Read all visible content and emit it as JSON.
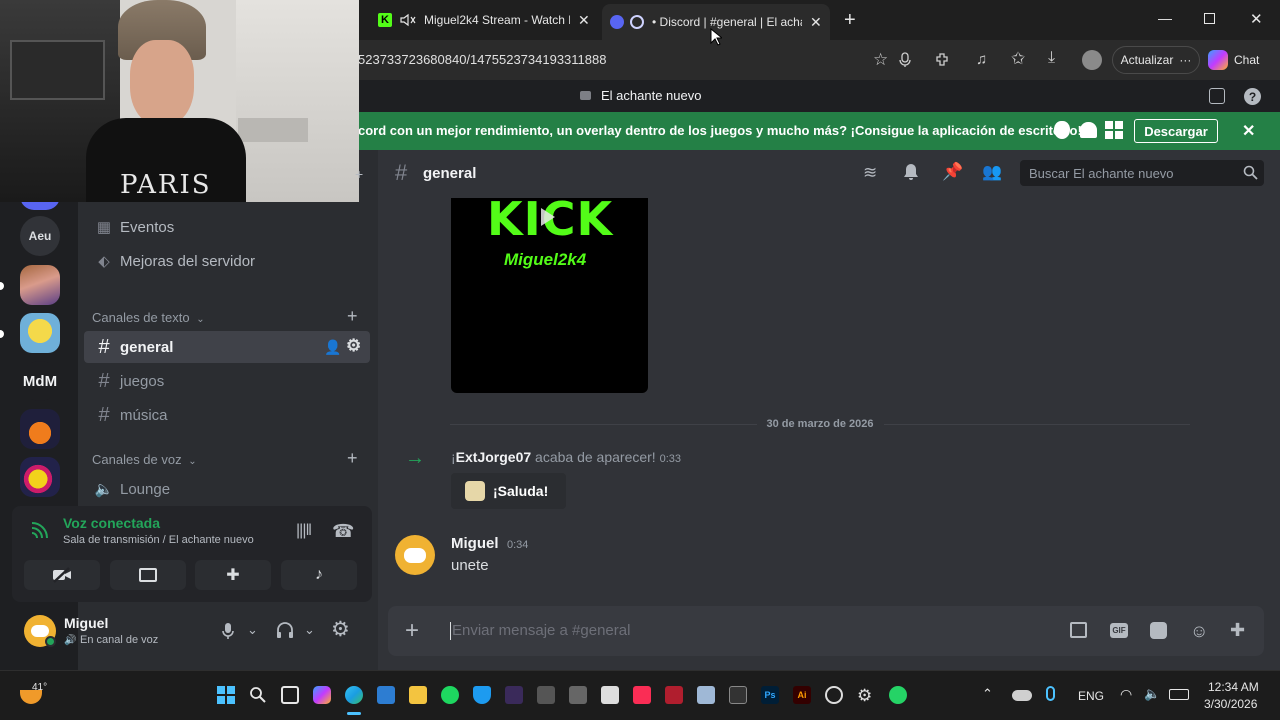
{
  "browser": {
    "tabs": [
      {
        "title": "Miguel2k4 Stream - Watch L",
        "favicon": "kick-icon"
      },
      {
        "title": "• Discord | #general | El acha",
        "favicon": "discord-icon"
      }
    ],
    "url": "523733723680840/1475523734193311888",
    "update_label": "Actualizar",
    "chat_label": "Chat"
  },
  "discord": {
    "server_title": "El achante nuevo",
    "banner": {
      "text": "cord con un mejor rendimiento, un overlay dentro de los juegos y mucho más? ¡Consigue la aplicación de escritorio!",
      "download_label": "Descargar"
    },
    "servers": {
      "aeu_label": "Aeu",
      "mdm_label": "MdM"
    },
    "menu": {
      "events": "Eventos",
      "boosts": "Mejoras del servidor"
    },
    "categories": {
      "text": "Canales de texto",
      "voice": "Canales de voz"
    },
    "channels": {
      "general": "general",
      "juegos": "juegos",
      "musica": "música",
      "lounge": "Lounge"
    },
    "voice": {
      "status": "Voz conectada",
      "detail": "Sala de transmisión / El achante nuevo"
    },
    "user": {
      "name": "Miguel",
      "status": "En canal de voz"
    },
    "chat": {
      "channel": "general",
      "search_placeholder": "Buscar El achante nuevo",
      "embed_brand": "KICK",
      "embed_user": "Miguel2k4",
      "date_divider": "30 de marzo de 2026",
      "join_prefix": "¡",
      "join_user": "ExtJorge07",
      "join_text": "acaba de aparecer!",
      "join_time": "0:33",
      "wave_label": "¡Saluda!",
      "message_author": "Miguel",
      "message_time": "0:34",
      "message_text": "unete",
      "composer_placeholder": "Enviar mensaje a #general"
    }
  },
  "webcam": {
    "shirt_text": "PARIS"
  },
  "taskbar": {
    "weather": "41°",
    "language": "ENG",
    "time": "12:34 AM",
    "date": "3/30/2026"
  },
  "colors": {
    "discord_green": "#248046",
    "blurple": "#5865f2",
    "kick_green": "#53fc18",
    "avatar_yellow": "#f0b232"
  }
}
